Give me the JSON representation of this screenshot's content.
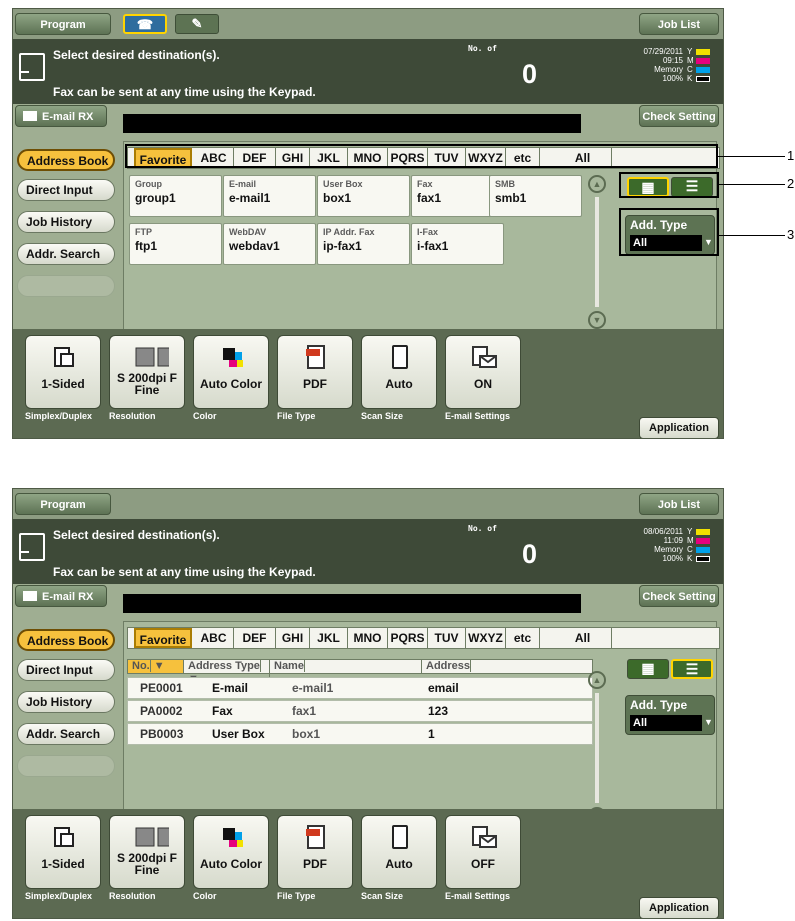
{
  "common": {
    "program_label": "Program",
    "joblist_label": "Job List",
    "message_line1": "Select desired destination(s).",
    "message_line2": "Fax can be sent at any time using the Keypad.",
    "no_of_label": "No. of",
    "destination_count": "0",
    "memory_label": "Memory",
    "memory_percent": "100%",
    "toner_labels": [
      "Y",
      "M",
      "C",
      "K"
    ],
    "toner_colors": [
      "#f2e100",
      "#e6007e",
      "#00a0e9",
      "#000000"
    ],
    "email_rx_label": "E-mail RX",
    "check_setting_label": "Check Setting",
    "application_label": "Application",
    "sidebar": [
      "Address Book",
      "Direct Input",
      "Job History",
      "Addr. Search"
    ],
    "alpha_tabs": [
      "Favorite",
      "ABC",
      "DEF",
      "GHI",
      "JKL",
      "MNO",
      "PQRS",
      "TUV",
      "WXYZ",
      "etc",
      "All"
    ],
    "add_type_label": "Add. Type",
    "add_type_value": "All",
    "accent_color": "#f6c13d"
  },
  "screen1": {
    "date": "07/29/2011",
    "time": "09:15",
    "destinations": [
      {
        "type": "Group",
        "name": "group1"
      },
      {
        "type": "E-mail",
        "name": "e-mail1"
      },
      {
        "type": "User Box",
        "name": "box1"
      },
      {
        "type": "Fax",
        "name": "fax1"
      },
      {
        "type": "SMB",
        "name": "smb1"
      },
      {
        "type": "FTP",
        "name": "ftp1"
      },
      {
        "type": "WebDAV",
        "name": "webdav1"
      },
      {
        "type": "IP Addr. Fax",
        "name": "ip-fax1"
      },
      {
        "type": "I-Fax",
        "name": "i-fax1"
      }
    ],
    "settings": [
      {
        "value": "1-Sided",
        "label": "Simplex/Duplex",
        "icon": "simplex-icon"
      },
      {
        "value": "S 200dpi F Fine",
        "label": "Resolution",
        "icon": "resolution-icon"
      },
      {
        "value": "Auto Color",
        "label": "Color",
        "icon": "color-icon"
      },
      {
        "value": "PDF",
        "label": "File Type",
        "icon": "pdf-icon"
      },
      {
        "value": "Auto",
        "label": "Scan Size",
        "icon": "scan-size-icon"
      },
      {
        "value": "ON",
        "label": "E-mail Settings",
        "icon": "email-settings-icon"
      }
    ],
    "callouts": [
      "1",
      "2",
      "3"
    ]
  },
  "screen2": {
    "date": "08/06/2011",
    "time": "11:09",
    "list_headers": [
      "No.",
      "Address Type",
      "Name",
      "Address"
    ],
    "rows": [
      {
        "no": "PE0001",
        "type": "E-mail",
        "name": "e-mail1",
        "address": "email"
      },
      {
        "no": "PA0002",
        "type": "Fax",
        "name": "fax1",
        "address": "123"
      },
      {
        "no": "PB0003",
        "type": "User Box",
        "name": "box1",
        "address": "1"
      }
    ],
    "settings": [
      {
        "value": "1-Sided",
        "label": "Simplex/Duplex",
        "icon": "simplex-icon"
      },
      {
        "value": "S 200dpi F Fine",
        "label": "Resolution",
        "icon": "resolution-icon"
      },
      {
        "value": "Auto Color",
        "label": "Color",
        "icon": "color-icon"
      },
      {
        "value": "PDF",
        "label": "File Type",
        "icon": "pdf-icon"
      },
      {
        "value": "Auto",
        "label": "Scan Size",
        "icon": "scan-size-icon"
      },
      {
        "value": "OFF",
        "label": "E-mail Settings",
        "icon": "email-settings-icon"
      }
    ]
  }
}
